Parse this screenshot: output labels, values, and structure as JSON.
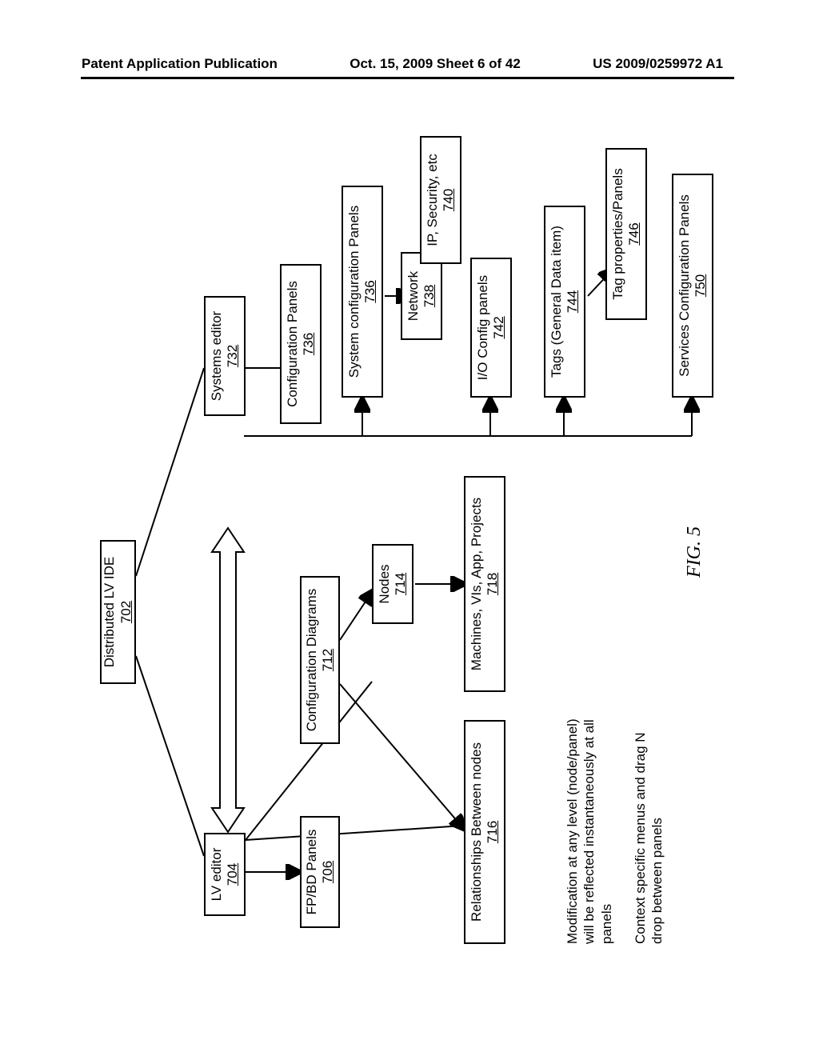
{
  "header": {
    "left": "Patent Application Publication",
    "center": "Oct. 15, 2009  Sheet 6 of 42",
    "right": "US 2009/0259972 A1"
  },
  "fig_label": "FIG. 5",
  "nodes": {
    "root": {
      "label": "Distributed LV IDE",
      "ref": "702"
    },
    "lv_editor": {
      "label": "LV editor",
      "ref": "704"
    },
    "fpbd": {
      "label": "FP/BD Panels",
      "ref": "706"
    },
    "cfg_diag": {
      "label": "Configuration Diagrams",
      "ref": "712"
    },
    "nodes_box": {
      "label": "Nodes",
      "ref": "714"
    },
    "rel": {
      "label": "Relationships Between nodes",
      "ref": "716"
    },
    "mvap": {
      "label": "Machines, VIs, App, Projects",
      "ref": "718"
    },
    "sys_editor": {
      "label": "Systems editor",
      "ref": "732"
    },
    "cfg_panels": {
      "label": "Configuration Panels",
      "ref": "736"
    },
    "sys_cfg": {
      "label": "System configuration Panels",
      "ref": "736"
    },
    "network": {
      "label": "Network",
      "ref": "738"
    },
    "ipsec": {
      "label": "IP, Security, etc",
      "ref": "740"
    },
    "io_cfg": {
      "label": "I/O Config panels",
      "ref": "742"
    },
    "tags": {
      "label": "Tags (General Data item)",
      "ref": "744"
    },
    "tag_props": {
      "label": "Tag properties/Panels",
      "ref": "746"
    },
    "services": {
      "label": "Services Configuration Panels",
      "ref": "750"
    }
  },
  "notes": {
    "mod": "Modification at any level (node/panel) will be reflected instantaneously at all panels",
    "ctx": "Context specific menus and drag N drop between panels"
  }
}
